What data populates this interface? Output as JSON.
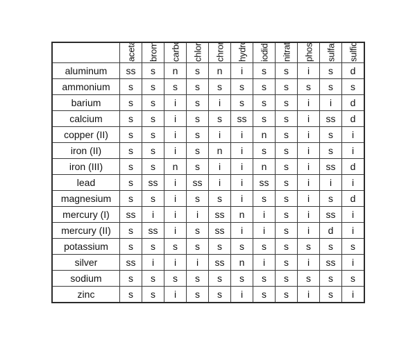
{
  "table": {
    "caption": "",
    "corner_label": "",
    "column_headers": [
      "acetate",
      "bromide",
      "carbonate",
      "chloride",
      "chromate",
      "hydroxide",
      "iodide",
      "nitrate",
      "phosphate",
      "sulfate",
      "sulfide"
    ],
    "row_labels": [
      "aluminum",
      "ammonium",
      "barium",
      "calcium",
      "copper (II)",
      "iron (II)",
      "iron (III)",
      "lead",
      "magnesium",
      "mercury (I)",
      "mercury (II)",
      "potassium",
      "silver",
      "sodium",
      "zinc"
    ],
    "rows": [
      {
        "label": "aluminum",
        "values": [
          "ss",
          "s",
          "n",
          "s",
          "n",
          "i",
          "s",
          "s",
          "i",
          "s",
          "d"
        ]
      },
      {
        "label": "ammonium",
        "values": [
          "s",
          "s",
          "s",
          "s",
          "s",
          "s",
          "s",
          "s",
          "s",
          "s",
          "s"
        ]
      },
      {
        "label": "barium",
        "values": [
          "s",
          "s",
          "i",
          "s",
          "i",
          "s",
          "s",
          "s",
          "i",
          "i",
          "d"
        ]
      },
      {
        "label": "calcium",
        "values": [
          "s",
          "s",
          "i",
          "s",
          "s",
          "ss",
          "s",
          "s",
          "i",
          "ss",
          "d"
        ]
      },
      {
        "label": "copper (II)",
        "values": [
          "s",
          "s",
          "i",
          "s",
          "i",
          "i",
          "n",
          "s",
          "i",
          "s",
          "i"
        ]
      },
      {
        "label": "iron (II)",
        "values": [
          "s",
          "s",
          "i",
          "s",
          "n",
          "i",
          "s",
          "s",
          "i",
          "s",
          "i"
        ]
      },
      {
        "label": "iron (III)",
        "values": [
          "s",
          "s",
          "n",
          "s",
          "i",
          "i",
          "n",
          "s",
          "i",
          "ss",
          "d"
        ]
      },
      {
        "label": "lead",
        "values": [
          "s",
          "ss",
          "i",
          "ss",
          "i",
          "i",
          "ss",
          "s",
          "i",
          "i",
          "i"
        ]
      },
      {
        "label": "magnesium",
        "values": [
          "s",
          "s",
          "i",
          "s",
          "s",
          "i",
          "s",
          "s",
          "i",
          "s",
          "d"
        ]
      },
      {
        "label": "mercury (I)",
        "values": [
          "ss",
          "i",
          "i",
          "i",
          "ss",
          "n",
          "i",
          "s",
          "i",
          "ss",
          "i"
        ]
      },
      {
        "label": "mercury (II)",
        "values": [
          "s",
          "ss",
          "i",
          "s",
          "ss",
          "i",
          "i",
          "s",
          "i",
          "d",
          "i"
        ]
      },
      {
        "label": "potassium",
        "values": [
          "s",
          "s",
          "s",
          "s",
          "s",
          "s",
          "s",
          "s",
          "s",
          "s",
          "s"
        ]
      },
      {
        "label": "silver",
        "values": [
          "ss",
          "i",
          "i",
          "i",
          "ss",
          "n",
          "i",
          "s",
          "i",
          "ss",
          "i"
        ]
      },
      {
        "label": "sodium",
        "values": [
          "s",
          "s",
          "s",
          "s",
          "s",
          "s",
          "s",
          "s",
          "s",
          "s",
          "s"
        ]
      },
      {
        "label": "zinc",
        "values": [
          "s",
          "s",
          "i",
          "s",
          "s",
          "i",
          "s",
          "s",
          "i",
          "s",
          "i"
        ]
      }
    ]
  },
  "colors": {
    "page_background": "#ffffff",
    "cell_background": "#ffffff",
    "border": "#3a3a3a",
    "outer_border": "#2b2b2b",
    "text": "#111111"
  }
}
